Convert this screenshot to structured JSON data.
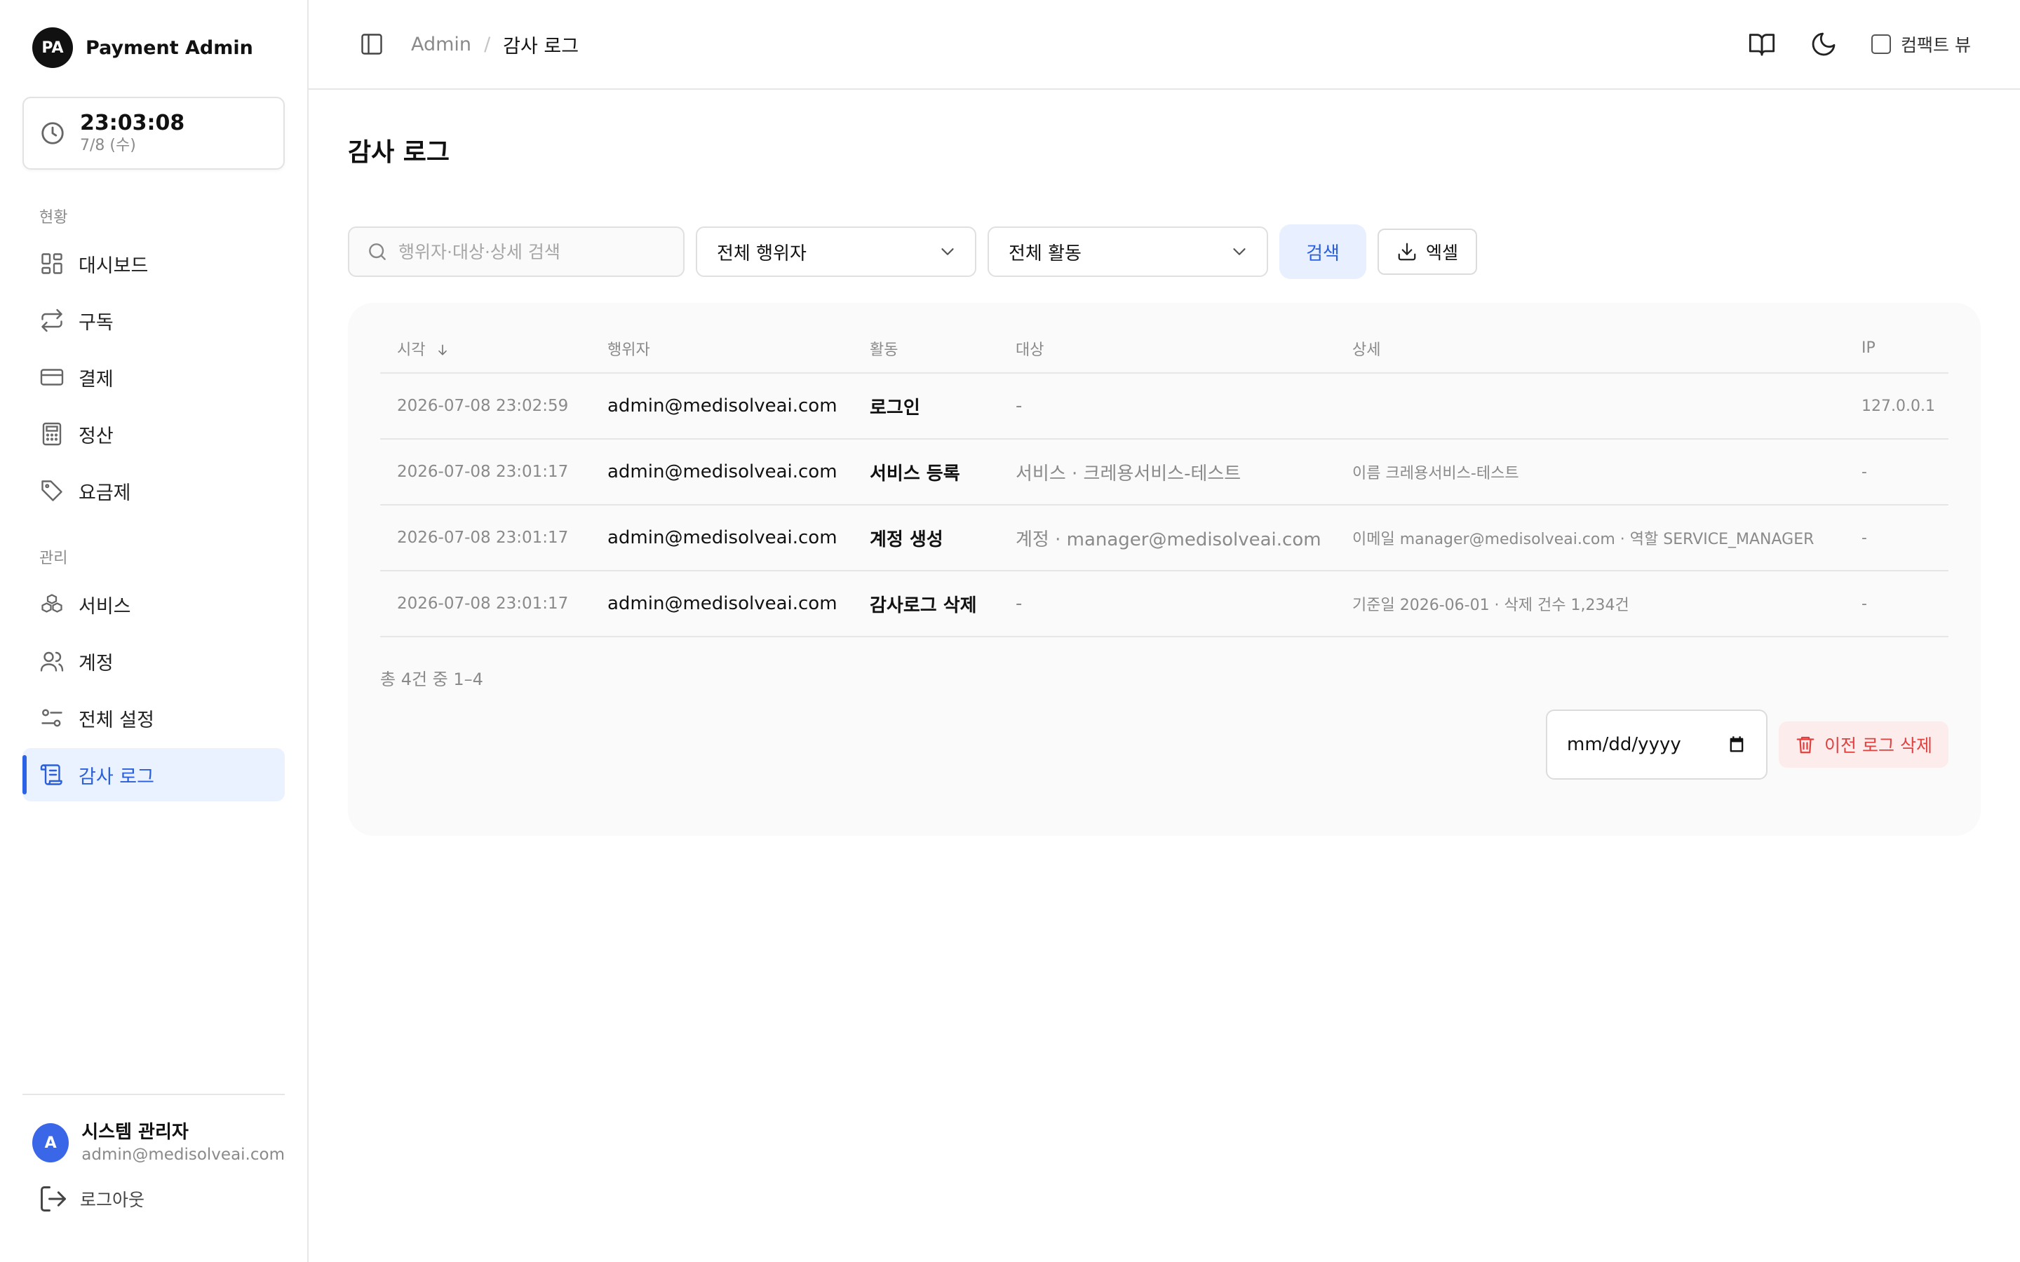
{
  "brand": {
    "logo_text": "PA",
    "name": "Payment Admin"
  },
  "clock": {
    "time": "23:03:08",
    "date": "7/8 (수)"
  },
  "sidebar": {
    "sections": [
      {
        "label": "현황",
        "items": [
          {
            "label": "대시보드",
            "icon": "dashboard-icon"
          },
          {
            "label": "구독",
            "icon": "repeat-icon"
          },
          {
            "label": "결제",
            "icon": "credit-card-icon"
          },
          {
            "label": "정산",
            "icon": "calculator-icon"
          },
          {
            "label": "요금제",
            "icon": "tag-icon"
          }
        ]
      },
      {
        "label": "관리",
        "items": [
          {
            "label": "서비스",
            "icon": "boxes-icon"
          },
          {
            "label": "계정",
            "icon": "users-icon"
          },
          {
            "label": "전체 설정",
            "icon": "sliders-icon"
          },
          {
            "label": "감사 로그",
            "icon": "scroll-icon",
            "active": true
          }
        ]
      }
    ]
  },
  "user": {
    "initial": "A",
    "name": "시스템 관리자",
    "email": "admin@medisolveai.com"
  },
  "logout_label": "로그아웃",
  "topbar": {
    "breadcrumb_root": "Admin",
    "breadcrumb_sep": "/",
    "breadcrumb_current": "감사 로그",
    "compact_label": "컴팩트 뷰"
  },
  "page_title": "감사 로그",
  "filters": {
    "search_placeholder": "행위자·대상·상세 검색",
    "actor_select": "전체 행위자",
    "activity_select": "전체 활동",
    "search_button": "검색",
    "excel_button": "엑셀"
  },
  "table": {
    "headers": {
      "time": "시각",
      "actor": "행위자",
      "action": "활동",
      "target": "대상",
      "detail": "상세",
      "ip": "IP"
    },
    "rows": [
      {
        "time": "2026-07-08 23:02:59",
        "actor": "admin@medisolveai.com",
        "action": "로그인",
        "target": "-",
        "detail": "",
        "ip": "127.0.0.1"
      },
      {
        "time": "2026-07-08 23:01:17",
        "actor": "admin@medisolveai.com",
        "action": "서비스 등록",
        "target": "서비스 · 크레용서비스-테스트",
        "detail": "이름 크레용서비스-테스트",
        "ip": "-"
      },
      {
        "time": "2026-07-08 23:01:17",
        "actor": "admin@medisolveai.com",
        "action": "계정 생성",
        "target": "계정 · manager@medisolveai.com",
        "detail": "이메일 manager@medisolveai.com · 역할 SERVICE_MANAGER",
        "ip": "-"
      },
      {
        "time": "2026-07-08 23:01:17",
        "actor": "admin@medisolveai.com",
        "action": "감사로그 삭제",
        "target": "-",
        "detail": "기준일 2026-06-01 · 삭제 건수 1,234건",
        "ip": "-"
      }
    ]
  },
  "pager_text": "총 4건 중 1–4",
  "delete_controls": {
    "date_placeholder": "mm/dd/yyyy",
    "delete_button": "이전 로그 삭제"
  }
}
